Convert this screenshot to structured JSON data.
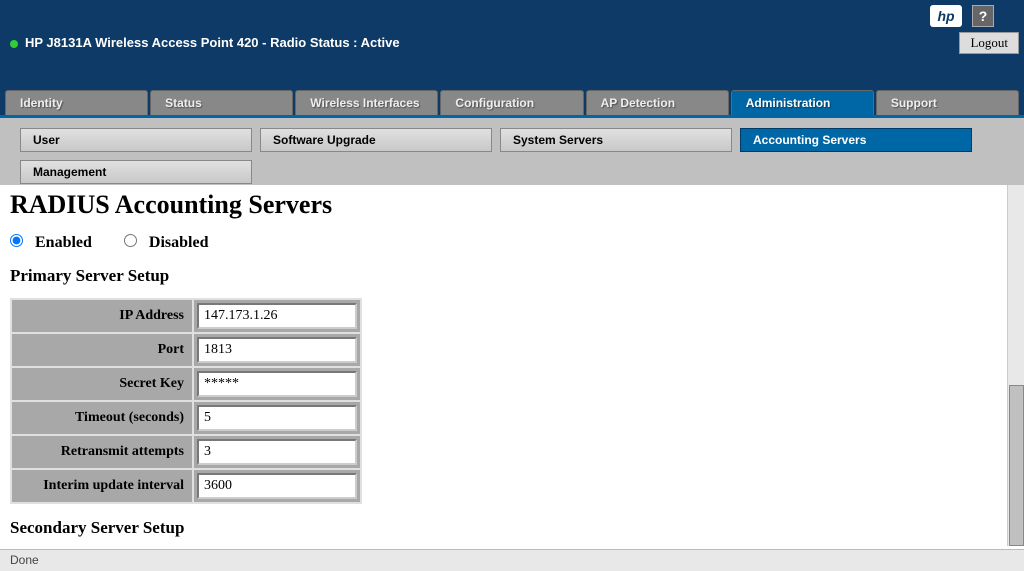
{
  "header": {
    "title": "HP J8131A Wireless Access Point 420 - Radio Status : Active",
    "logo_text": "hp",
    "help_text": "?",
    "logout_label": "Logout"
  },
  "main_tabs": [
    {
      "label": "Identity",
      "active": false
    },
    {
      "label": "Status",
      "active": false
    },
    {
      "label": "Wireless Interfaces",
      "active": false
    },
    {
      "label": "Configuration",
      "active": false
    },
    {
      "label": "AP Detection",
      "active": false
    },
    {
      "label": "Administration",
      "active": true
    },
    {
      "label": "Support",
      "active": false
    }
  ],
  "sub_tabs": [
    {
      "label": "User",
      "active": false
    },
    {
      "label": "Software Upgrade",
      "active": false
    },
    {
      "label": "System Servers",
      "active": false
    },
    {
      "label": "Accounting Servers",
      "active": true
    },
    {
      "label": "Management",
      "active": false
    }
  ],
  "page": {
    "title": "RADIUS Accounting Servers",
    "radio_enabled_label": "Enabled",
    "radio_disabled_label": "Disabled",
    "radio_state": "enabled",
    "primary_heading": "Primary Server Setup",
    "secondary_heading": "Secondary Server Setup",
    "fields": {
      "ip_address": {
        "label": "IP Address",
        "value": "147.173.1.26"
      },
      "port": {
        "label": "Port",
        "value": "1813"
      },
      "secret_key": {
        "label": "Secret Key",
        "value": "*****"
      },
      "timeout": {
        "label": "Timeout (seconds)",
        "value": "5"
      },
      "retransmit": {
        "label": "Retransmit attempts",
        "value": "3"
      },
      "interim": {
        "label": "Interim update interval",
        "value": "3600"
      }
    }
  },
  "status_bar": {
    "text": "Done"
  }
}
